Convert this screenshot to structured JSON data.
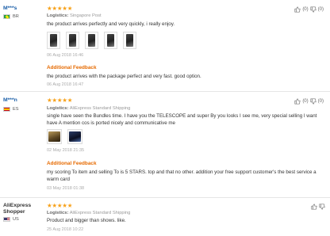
{
  "reviews": [
    {
      "user": "M***s",
      "country": "BR",
      "stars": "★★★★★",
      "logistics_label": "Logistics:",
      "logistics": "Singapore Post",
      "text": "the product arrives perfectly and very quickly, i really enjoy.",
      "date": "06 Aug 2018 16:46",
      "additional_title": "Additional Feedback",
      "additional_text": "the product arrives with the package perfect and very fast. good option.",
      "additional_date": "06 Aug 2018 16:47",
      "helpful_up": "(0)",
      "helpful_down": "(0)"
    },
    {
      "user": "M***n",
      "country": "ES",
      "stars": "★★★★★",
      "logistics_label": "Logistics:",
      "logistics": "AliExpress Standard Shipping",
      "text": "single have seen the Bundles time. I have you the TELESCOPE and super By you looks I see me, very special selling I want have A mention cos is ported nicely and communicative me",
      "date": "02 May 2018 21:35",
      "additional_title": "Additional Feedback",
      "additional_text": "my scoring To item and selling To is 5 STARS. top and that no other. addition your free support customer's the best service a warm card",
      "additional_date": "03 May 2018 01:38",
      "helpful_up": "(0)",
      "helpful_down": "(0)"
    },
    {
      "user": "AliExpress Shopper",
      "country": "US",
      "stars": "★★★★★",
      "logistics_label": "Logistics:",
      "logistics": "AliExpress Standard Shipping",
      "text": "Product and bigger than shows. like.",
      "date": "25 Aug 2018 10:22",
      "helpful_up": "",
      "helpful_down": ""
    }
  ],
  "colors": {
    "star": "#f7a21b",
    "additional_feedback": "#e66a00",
    "username_link": "#1a5ea8"
  },
  "icons": {
    "helpful": "thumbs-up-icon",
    "unhelpful": "thumbs-down-icon"
  }
}
